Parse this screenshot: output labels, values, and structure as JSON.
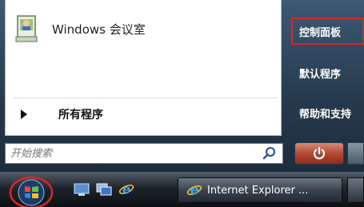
{
  "start_menu": {
    "pinned_program": {
      "label": "Windows 会议室",
      "icon": "meeting-space-icon"
    },
    "all_programs_label": "所有程序",
    "search": {
      "placeholder": "开始搜索",
      "value": "",
      "icon": "search-icon"
    },
    "right_links": [
      {
        "label": "控制面板",
        "selected": true
      },
      {
        "label": "默认程序",
        "selected": false
      },
      {
        "label": "帮助和支持",
        "selected": false
      }
    ],
    "power_icon": "power-icon"
  },
  "taskbar": {
    "start_icon": "windows-orb-icon",
    "quick_launch": [
      "show-desktop-icon",
      "switch-windows-icon",
      "internet-explorer-icon"
    ],
    "task_button_label": "Internet Explorer ..."
  },
  "colors": {
    "highlight_border": "#d8262b",
    "menu_right_bg": "#2c4256",
    "power_button": "#b24a33"
  }
}
